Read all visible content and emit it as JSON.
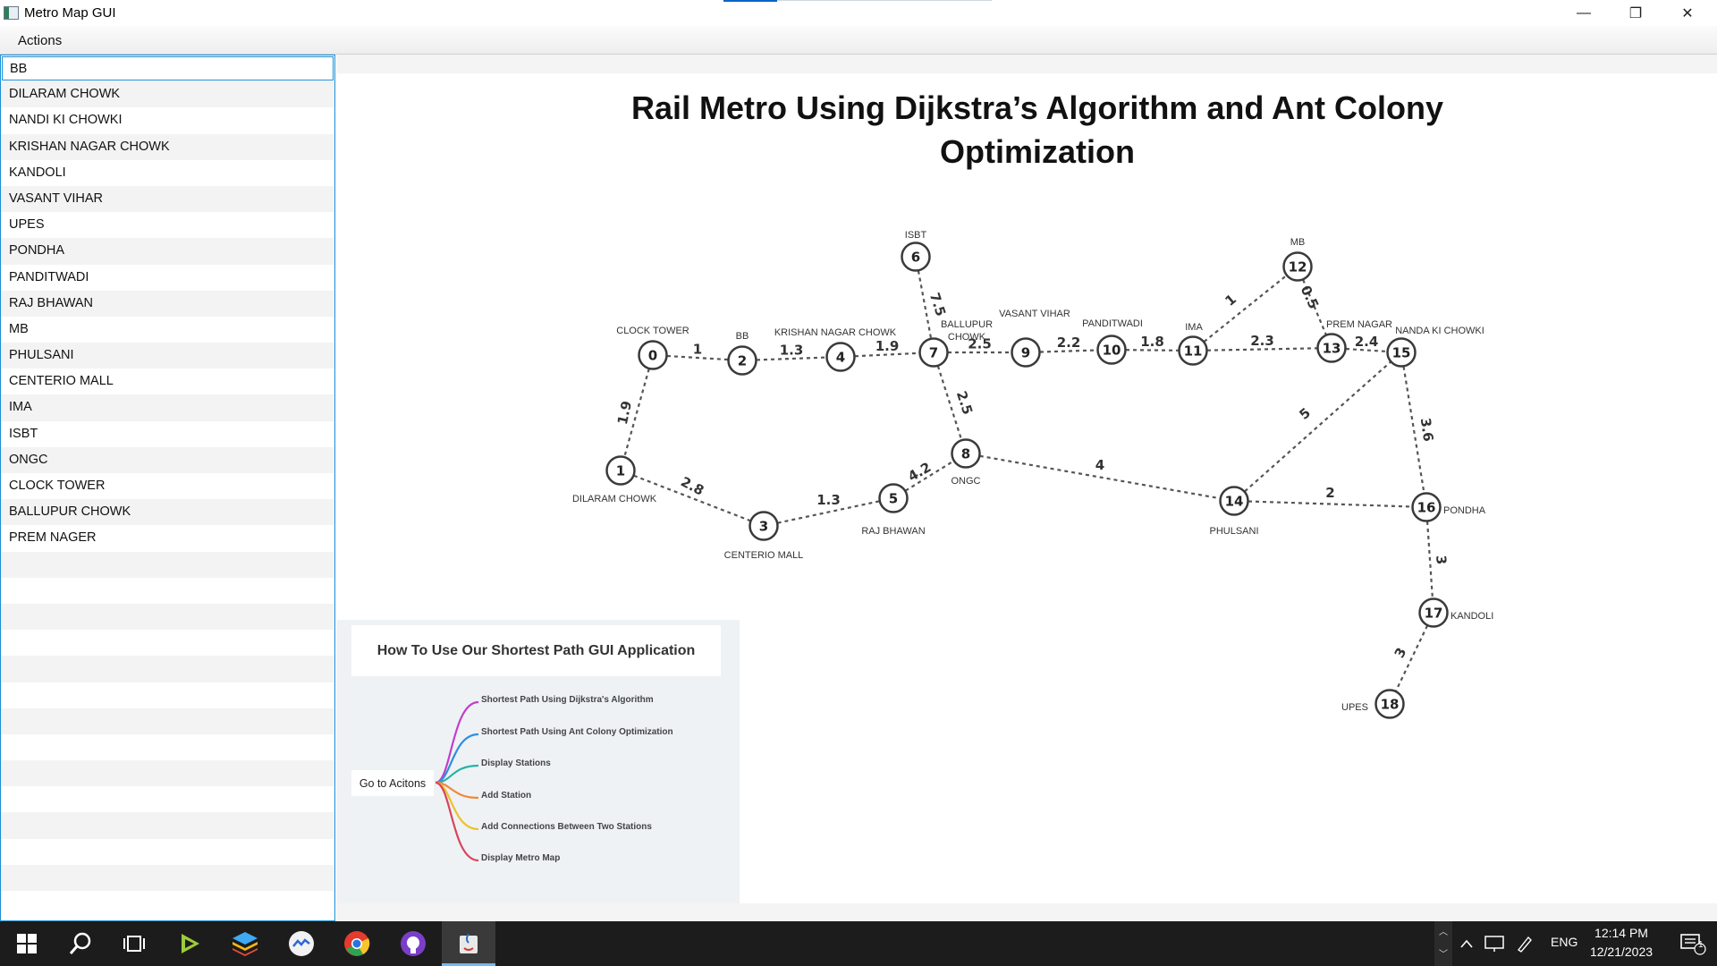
{
  "window": {
    "title": "Metro Map GUI",
    "minimize_glyph": "—",
    "maximize_glyph": "❐",
    "close_glyph": "✕"
  },
  "menu": {
    "actions_label": "Actions"
  },
  "stations_list": [
    "BB",
    "DILARAM CHOWK",
    "NANDI KI CHOWKI",
    "KRISHAN NAGAR CHOWK",
    "KANDOLI",
    "VASANT VIHAR",
    "UPES",
    "PONDHA",
    "PANDITWADI",
    "RAJ BHAWAN",
    "MB",
    "PHULSANI",
    "CENTERIO MALL",
    "IMA",
    "ISBT",
    "ONGC",
    "CLOCK TOWER",
    "BALLUPUR CHOWK",
    "PREM NAGER"
  ],
  "selected_station": "BB",
  "map": {
    "title_line1": "Rail Metro Using Dijkstra’s Algorithm and Ant Colony",
    "title_line2": "Optimization",
    "nodes": [
      {
        "id": "0",
        "label": "CLOCK TOWER"
      },
      {
        "id": "1",
        "label": "DILARAM CHOWK"
      },
      {
        "id": "2",
        "label": "BB"
      },
      {
        "id": "3",
        "label": "CENTERIO MALL"
      },
      {
        "id": "4",
        "label": "KRISHAN NAGAR CHOWK"
      },
      {
        "id": "5",
        "label": "RAJ BHAWAN"
      },
      {
        "id": "6",
        "label": "ISBT"
      },
      {
        "id": "7",
        "label": "BALLUPUR CHOWK"
      },
      {
        "id": "8",
        "label": "ONGC"
      },
      {
        "id": "9",
        "label": "VASANT VIHAR"
      },
      {
        "id": "10",
        "label": "PANDITWADI"
      },
      {
        "id": "11",
        "label": "IMA"
      },
      {
        "id": "12",
        "label": "MB"
      },
      {
        "id": "13",
        "label": "PREM NAGAR"
      },
      {
        "id": "14",
        "label": "PHULSANI"
      },
      {
        "id": "15",
        "label": "NANDA KI CHOWKI"
      },
      {
        "id": "16",
        "label": "PONDHA"
      },
      {
        "id": "17",
        "label": "KANDOLI"
      },
      {
        "id": "18",
        "label": "UPES"
      }
    ],
    "edges": [
      {
        "from": "0",
        "to": "2",
        "weight": "1"
      },
      {
        "from": "2",
        "to": "4",
        "weight": "1.3"
      },
      {
        "from": "4",
        "to": "7",
        "weight": "1.9"
      },
      {
        "from": "7",
        "to": "9",
        "weight": "2.5"
      },
      {
        "from": "9",
        "to": "10",
        "weight": "2.2"
      },
      {
        "from": "10",
        "to": "11",
        "weight": "1.8"
      },
      {
        "from": "11",
        "to": "13",
        "weight": "2.3"
      },
      {
        "from": "13",
        "to": "15",
        "weight": "2.4"
      },
      {
        "from": "11",
        "to": "12",
        "weight": "1"
      },
      {
        "from": "12",
        "to": "13",
        "weight": "0.5"
      },
      {
        "from": "6",
        "to": "7",
        "weight": "7.5"
      },
      {
        "from": "7",
        "to": "8",
        "weight": "2.5"
      },
      {
        "from": "0",
        "to": "1",
        "weight": "1.9"
      },
      {
        "from": "1",
        "to": "3",
        "weight": "2.8"
      },
      {
        "from": "3",
        "to": "5",
        "weight": "1.3"
      },
      {
        "from": "5",
        "to": "8",
        "weight": "4.2"
      },
      {
        "from": "8",
        "to": "14",
        "weight": "4"
      },
      {
        "from": "14",
        "to": "15",
        "weight": "5"
      },
      {
        "from": "14",
        "to": "16",
        "weight": "2"
      },
      {
        "from": "15",
        "to": "16",
        "weight": "3.6"
      },
      {
        "from": "16",
        "to": "17",
        "weight": "3"
      },
      {
        "from": "17",
        "to": "18",
        "weight": "3"
      }
    ]
  },
  "help": {
    "title": "How To Use Our Shortest Path GUI Application",
    "root": "Go to Acitons",
    "items": [
      "Shortest Path Using Dijkstra's Algorithm",
      "Shortest Path Using Ant Colony Optimization",
      "Display Stations",
      "Add Station",
      "Add Connections Between Two Stations",
      "Display Metro Map"
    ],
    "branch_colors": [
      "#c23ec9",
      "#2f8fe0",
      "#26b3a6",
      "#f0883a",
      "#f0c02a",
      "#d9435b"
    ]
  },
  "taskbar": {
    "language": "ENG",
    "time": "12:14 PM",
    "date": "12/21/2023",
    "notification_count": "1",
    "icons": [
      "windows-start-icon",
      "search-icon",
      "task-view-icon",
      "game-app-icon",
      "bluestacks-icon",
      "chat-app-icon",
      "chrome-icon",
      "github-icon",
      "java-icon"
    ]
  }
}
